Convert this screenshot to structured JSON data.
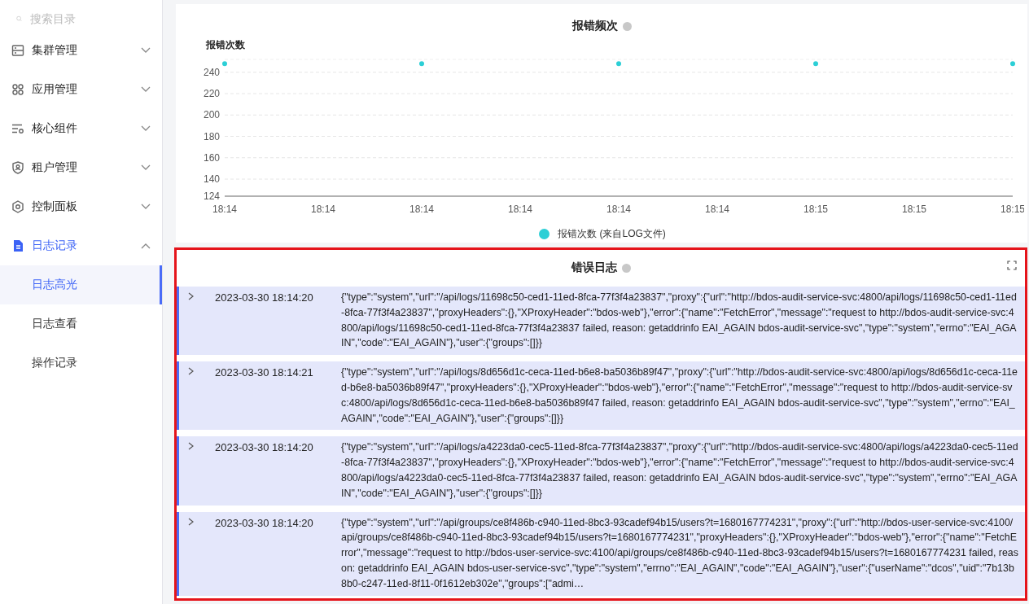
{
  "sidebar": {
    "search": {
      "placeholder": "搜索目录"
    },
    "items": [
      {
        "label": "集群管理",
        "expanded": false,
        "active": false
      },
      {
        "label": "应用管理",
        "expanded": false,
        "active": false
      },
      {
        "label": "核心组件",
        "expanded": false,
        "active": false
      },
      {
        "label": "租户管理",
        "expanded": false,
        "active": false
      },
      {
        "label": "控制面板",
        "expanded": false,
        "active": false
      },
      {
        "label": "日志记录",
        "expanded": true,
        "active": true,
        "children": [
          {
            "label": "日志高光",
            "selected": true
          },
          {
            "label": "日志查看",
            "selected": false
          },
          {
            "label": "操作记录",
            "selected": false
          }
        ]
      }
    ]
  },
  "chart_card": {
    "title": "报错频次",
    "chart_data": {
      "type": "scatter",
      "grid": true,
      "ylabel": "报错次数",
      "categories": [
        "18:14",
        "18:14",
        "18:14",
        "18:14",
        "18:14",
        "18:14",
        "18:15",
        "18:15",
        "18:15"
      ],
      "series": [
        {
          "name": "报错次数 (来自LOG文件)",
          "color": "#2ccfd6",
          "values": [
            248,
            null,
            248,
            null,
            248,
            null,
            248,
            null,
            248
          ]
        }
      ],
      "ylim": [
        124,
        252
      ],
      "yticks": [
        124,
        140,
        160,
        180,
        200,
        220,
        240
      ]
    }
  },
  "log_card": {
    "title": "错误日志",
    "rows": [
      {
        "expanded": false,
        "time": "2023-03-30 18:14:20",
        "message": "{\"type\":\"system\",\"url\":\"/api/logs/11698c50-ced1-11ed-8fca-77f3f4a23837\",\"proxy\":{\"url\":\"http://bdos-audit-service-svc:4800/api/logs/11698c50-ced1-11ed-8fca-77f3f4a23837\",\"proxyHeaders\":{},\"XProxyHeader\":\"bdos-web\"},\"error\":{\"name\":\"FetchError\",\"message\":\"request to http://bdos-audit-service-svc:4800/api/logs/11698c50-ced1-11ed-8fca-77f3f4a23837 failed, reason: getaddrinfo EAI_AGAIN bdos-audit-service-svc\",\"type\":\"system\",\"errno\":\"EAI_AGAIN\",\"code\":\"EAI_AGAIN\"},\"user\":{\"groups\":[]}}"
      },
      {
        "expanded": false,
        "time": "2023-03-30 18:14:21",
        "message": "{\"type\":\"system\",\"url\":\"/api/logs/8d656d1c-ceca-11ed-b6e8-ba5036b89f47\",\"proxy\":{\"url\":\"http://bdos-audit-service-svc:4800/api/logs/8d656d1c-ceca-11ed-b6e8-ba5036b89f47\",\"proxyHeaders\":{},\"XProxyHeader\":\"bdos-web\"},\"error\":{\"name\":\"FetchError\",\"message\":\"request to http://bdos-audit-service-svc:4800/api/logs/8d656d1c-ceca-11ed-b6e8-ba5036b89f47 failed, reason: getaddrinfo EAI_AGAIN bdos-audit-service-svc\",\"type\":\"system\",\"errno\":\"EAI_AGAIN\",\"code\":\"EAI_AGAIN\"},\"user\":{\"groups\":[]}}"
      },
      {
        "expanded": false,
        "time": "2023-03-30 18:14:20",
        "message": "{\"type\":\"system\",\"url\":\"/api/logs/a4223da0-cec5-11ed-8fca-77f3f4a23837\",\"proxy\":{\"url\":\"http://bdos-audit-service-svc:4800/api/logs/a4223da0-cec5-11ed-8fca-77f3f4a23837\",\"proxyHeaders\":{},\"XProxyHeader\":\"bdos-web\"},\"error\":{\"name\":\"FetchError\",\"message\":\"request to http://bdos-audit-service-svc:4800/api/logs/a4223da0-cec5-11ed-8fca-77f3f4a23837 failed, reason: getaddrinfo EAI_AGAIN bdos-audit-service-svc\",\"type\":\"system\",\"errno\":\"EAI_AGAIN\",\"code\":\"EAI_AGAIN\"},\"user\":{\"groups\":[]}}"
      },
      {
        "expanded": false,
        "time": "2023-03-30 18:14:20",
        "message": "{\"type\":\"system\",\"url\":\"/api/groups/ce8f486b-c940-11ed-8bc3-93cadef94b15/users?t=1680167774231\",\"proxy\":{\"url\":\"http://bdos-user-service-svc:4100/api/groups/ce8f486b-c940-11ed-8bc3-93cadef94b15/users?t=1680167774231\",\"proxyHeaders\":{},\"XProxyHeader\":\"bdos-web\"},\"error\":{\"name\":\"FetchError\",\"message\":\"request to http://bdos-user-service-svc:4100/api/groups/ce8f486b-c940-11ed-8bc3-93cadef94b15/users?t=1680167774231 failed, reason: getaddrinfo EAI_AGAIN bdos-user-service-svc\",\"type\":\"system\",\"errno\":\"EAI_AGAIN\",\"code\":\"EAI_AGAIN\"},\"user\":{\"userName\":\"dcos\",\"uid\":\"7b13b8b0-c247-11ed-8f11-0f1612eb302e\",\"groups\":[\"admi…"
      }
    ]
  }
}
